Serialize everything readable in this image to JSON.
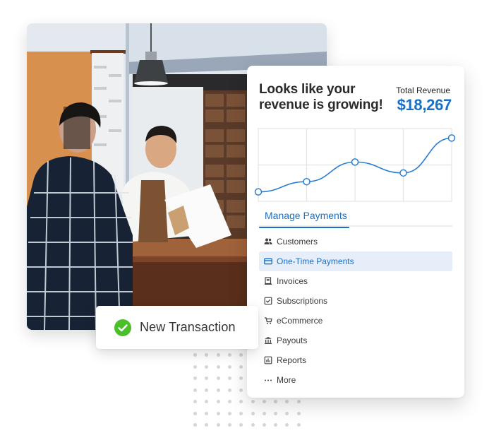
{
  "photo": {
    "subject": "cashier-handing-bag-to-customer",
    "colors": {
      "wall": "#e6ebef",
      "orange_panel": "#d98f52",
      "shirt_plaid": "#1b2536",
      "counter_wood": "#6b3b1f",
      "apron": "#8a5a33",
      "drawers": "#6b4530"
    }
  },
  "dashboard": {
    "headline": "Looks like your revenue is growing!",
    "total_revenue_label": "Total Revenue",
    "total_revenue_value": "$18,267",
    "tabs": [
      {
        "label": "Manage Payments",
        "active": true
      }
    ],
    "menu": [
      {
        "label": "Customers",
        "icon": "people-icon",
        "active": false
      },
      {
        "label": "One-Time Payments",
        "icon": "credit-card-icon",
        "active": true
      },
      {
        "label": "Invoices",
        "icon": "invoice-icon",
        "active": false
      },
      {
        "label": "Subscriptions",
        "icon": "checkbox-icon",
        "active": false
      },
      {
        "label": "eCommerce",
        "icon": "cart-icon",
        "active": false
      },
      {
        "label": "Payouts",
        "icon": "bank-icon",
        "active": false
      },
      {
        "label": "Reports",
        "icon": "report-icon",
        "active": false
      },
      {
        "label": "More",
        "icon": "more-icon",
        "active": false
      }
    ]
  },
  "toast": {
    "message": "New Transaction",
    "icon": "check-circle-icon"
  },
  "colors": {
    "accent": "#1870c9",
    "line": "#2b7fd4",
    "success": "#4bbf2a",
    "selected_bg": "#e5eef9",
    "grid": "#e4e4e4"
  },
  "chart_data": {
    "type": "line",
    "title": "",
    "xlabel": "",
    "ylabel": "",
    "x": [
      0,
      1,
      2,
      3,
      4
    ],
    "values": [
      13,
      27,
      54,
      39,
      87
    ],
    "ylim": [
      0,
      100
    ],
    "x_gridlines": 4,
    "y_gridlines": 2,
    "grid": true,
    "smooth": true,
    "markers": "hollow-circle",
    "legend": "none"
  }
}
